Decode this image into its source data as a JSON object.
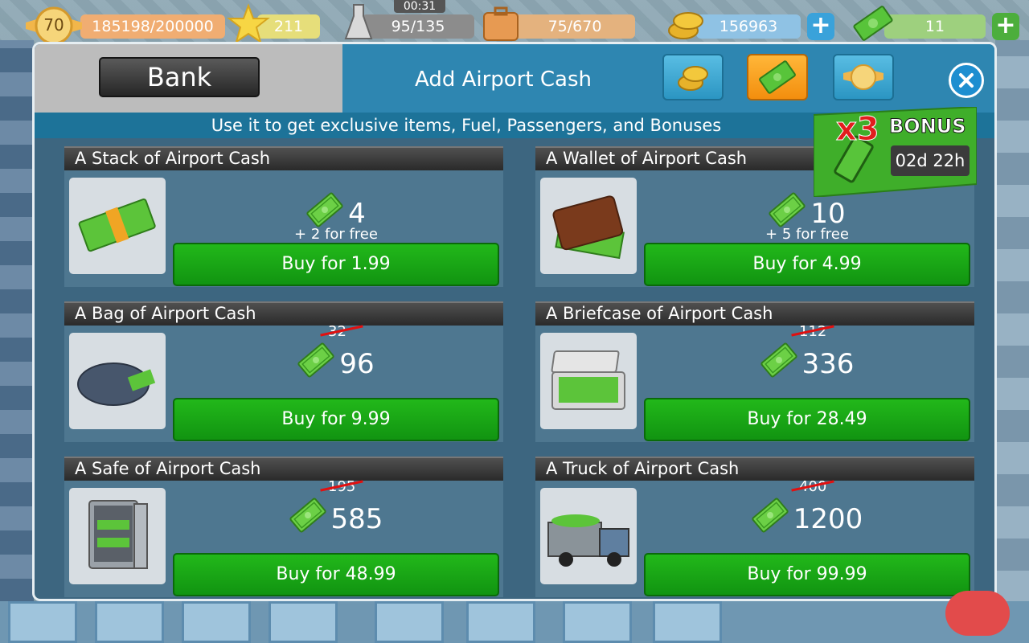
{
  "hud": {
    "level": "70",
    "xp": "185198/200000",
    "stars": "211",
    "timer": "00:31",
    "fuel": "95/135",
    "storage": "75/670",
    "coins": "156963",
    "cash": "11"
  },
  "dialog": {
    "bank_label": "Bank",
    "title": "Add Airport Cash",
    "subtitle": "Use it to get exclusive items, Fuel, Passengers, and Bonuses",
    "tabs": [
      {
        "icon": "coins-icon"
      },
      {
        "icon": "cash-icon",
        "active": true
      },
      {
        "icon": "wings-badge-icon"
      }
    ],
    "bonus": {
      "multiplier": "x3",
      "label": "BONUS",
      "time": "02d 22h"
    }
  },
  "packs": [
    {
      "title": "A Stack of Airport Cash",
      "amount": "4",
      "free": "+ 2 for free",
      "old": "",
      "buy": "Buy for 1.99",
      "icon": "cash-stack-icon"
    },
    {
      "title": "A Wallet of Airport Cash",
      "amount": "10",
      "free": "+ 5 for free",
      "old": "",
      "buy": "Buy for 4.99",
      "icon": "wallet-icon"
    },
    {
      "title": "A Bag of Airport Cash",
      "amount": "96",
      "free": "",
      "old": "32",
      "buy": "Buy for 9.99",
      "icon": "duffel-bag-icon"
    },
    {
      "title": "A Briefcase of Airport Cash",
      "amount": "336",
      "free": "",
      "old": "112",
      "buy": "Buy for 28.49",
      "icon": "briefcase-icon"
    },
    {
      "title": "A Safe of Airport Cash",
      "amount": "585",
      "free": "",
      "old": "195",
      "buy": "Buy for 48.99",
      "icon": "safe-icon"
    },
    {
      "title": "A Truck of Airport Cash",
      "amount": "1200",
      "free": "",
      "old": "400",
      "buy": "Buy for 99.99",
      "icon": "truck-icon"
    }
  ],
  "colors": {
    "buy_green": "#1aa516",
    "header_blue": "#2e86b1",
    "active_tab": "#f59a1a",
    "bonus_green": "#3fae2a"
  }
}
